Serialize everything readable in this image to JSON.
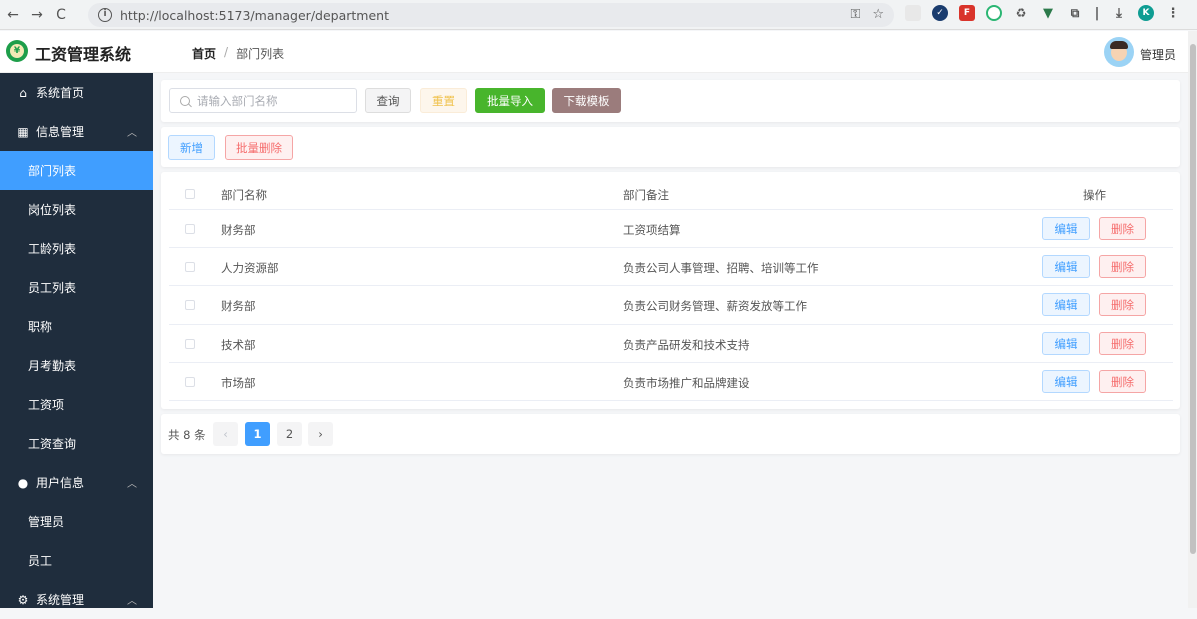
{
  "browser": {
    "url": "http://localhost:5173/manager/department",
    "back_icon": "←",
    "forward_icon": "→",
    "reload_icon": "C"
  },
  "header": {
    "app_title": "工资管理系统",
    "breadcrumb_home": "首页",
    "breadcrumb_sep": "/",
    "breadcrumb_current": "部门列表",
    "user_name": "管理员"
  },
  "sidebar": {
    "home": "系统首页",
    "info_group": "信息管理",
    "info_items": [
      "部门列表",
      "岗位列表",
      "工龄列表",
      "员工列表",
      "职称",
      "月考勤表",
      "工资项",
      "工资查询"
    ],
    "user_group": "用户信息",
    "user_items": [
      "管理员",
      "员工"
    ],
    "system_group": "系统管理"
  },
  "search": {
    "placeholder": "请输入部门名称",
    "query": "查询",
    "reset": "重置",
    "import": "批量导入",
    "template": "下载模板"
  },
  "actions": {
    "add": "新增",
    "batch_delete": "批量删除"
  },
  "table": {
    "headers": [
      "部门名称",
      "部门备注",
      "操作"
    ],
    "rows": [
      {
        "name": "财务部",
        "note": "工资项结算"
      },
      {
        "name": "人力资源部",
        "note": "负责公司人事管理、招聘、培训等工作"
      },
      {
        "name": "财务部",
        "note": "负责公司财务管理、薪资发放等工作"
      },
      {
        "name": "技术部",
        "note": "负责产品研发和技术支持"
      },
      {
        "name": "市场部",
        "note": "负责市场推广和品牌建设"
      }
    ],
    "edit_label": "编辑",
    "delete_label": "删除"
  },
  "pager": {
    "total": "共 8 条",
    "prev": "‹",
    "next": "›",
    "pages": [
      "1",
      "2"
    ]
  },
  "colors": {
    "primary": "#409eff",
    "sidebar_bg": "#1f2d3d",
    "success": "#48b52c",
    "danger": "#f56c6c"
  }
}
